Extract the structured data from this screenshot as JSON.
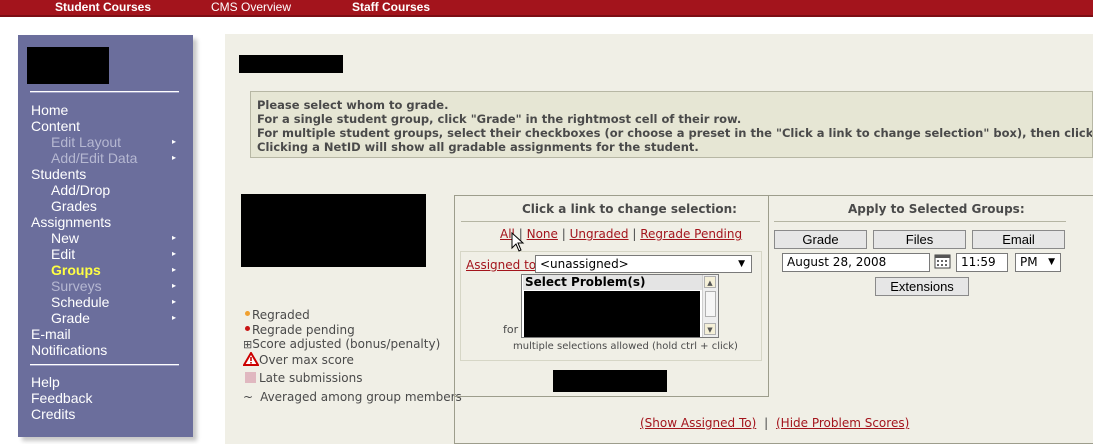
{
  "topnav": {
    "student_courses": "Student Courses",
    "cms_overview": "CMS Overview",
    "staff_courses": "Staff Courses"
  },
  "sidebar": {
    "items": [
      {
        "label": "Home",
        "level": 0,
        "state": "normal",
        "arrow": false
      },
      {
        "label": "Content",
        "level": 0,
        "state": "normal",
        "arrow": false
      },
      {
        "label": "Edit Layout",
        "level": 1,
        "state": "disabled",
        "arrow": true
      },
      {
        "label": "Add/Edit Data",
        "level": 1,
        "state": "disabled",
        "arrow": true
      },
      {
        "label": "Students",
        "level": 0,
        "state": "normal",
        "arrow": false
      },
      {
        "label": "Add/Drop",
        "level": 1,
        "state": "normal",
        "arrow": false
      },
      {
        "label": "Grades",
        "level": 1,
        "state": "normal",
        "arrow": false
      },
      {
        "label": "Assignments",
        "level": 0,
        "state": "normal",
        "arrow": false
      },
      {
        "label": "New",
        "level": 1,
        "state": "normal",
        "arrow": true
      },
      {
        "label": "Edit",
        "level": 1,
        "state": "normal",
        "arrow": true
      },
      {
        "label": "Groups",
        "level": 1,
        "state": "active",
        "arrow": true
      },
      {
        "label": "Surveys",
        "level": 1,
        "state": "disabled",
        "arrow": true
      },
      {
        "label": "Schedule",
        "level": 1,
        "state": "normal",
        "arrow": true
      },
      {
        "label": "Grade",
        "level": 1,
        "state": "normal",
        "arrow": true
      },
      {
        "label": "E-mail",
        "level": 0,
        "state": "normal",
        "arrow": false
      },
      {
        "label": "Notifications",
        "level": 0,
        "state": "normal",
        "arrow": false
      }
    ],
    "footer_items": [
      {
        "label": "Help"
      },
      {
        "label": "Feedback"
      },
      {
        "label": "Credits"
      }
    ],
    "arrow_glyph": "▸"
  },
  "instructions": [
    "Please select whom to grade.",
    "For a single student group, click \"Grade\" in the rightmost cell of their row.",
    "For multiple student groups, select their checkboxes (or choose a preset in the \"Click a link to change selection\" box), then click \"Grade\" at the top.",
    "Clicking a NetID will show all gradable assignments for the student."
  ],
  "legend": {
    "regraded": "Regraded",
    "regrade_pending": "Regrade pending",
    "score_adjusted": "Score adjusted (bonus/penalty)",
    "over_max": "Over max score",
    "late": "Late submissions",
    "averaged": "Averaged among group members",
    "averaged_symbol": "~",
    "adjusted_symbol": "⊞",
    "colors": {
      "regraded": "#f0a030",
      "regrade_pending": "#c81414",
      "late": "#e0b8c0",
      "over_max": "#cc0000"
    }
  },
  "selection": {
    "header": "Click a link to change selection:",
    "links": [
      "All",
      "None",
      "Ungraded",
      "Regrade Pending"
    ],
    "separator": "|",
    "assigned_to_label": "Assigned to",
    "assigned_value": "<unassigned>",
    "select_problems_header": "Select Problem(s)",
    "for_label": "for",
    "hint": "multiple selections allowed (hold ctrl + click)"
  },
  "apply": {
    "header": "Apply to Selected Groups:",
    "grade": "Grade",
    "files": "Files",
    "email": "Email",
    "date": "August 28, 2008",
    "time": "11:59",
    "ampm": "PM",
    "extensions": "Extensions"
  },
  "footer_links": {
    "show_assigned": "(Show Assigned To)",
    "separator": "|",
    "hide_scores": "(Hide Problem Scores)"
  }
}
